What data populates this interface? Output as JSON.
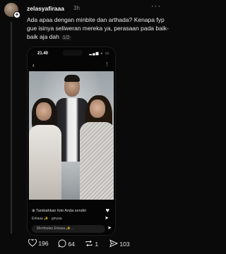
{
  "post": {
    "username": "zelasyafiraaa",
    "timestamp": "3h",
    "text": "Ada apaa dengan minbite dan arthada? Kenapa fyp gue isinya seliweran mereka ya, perasaan pada baik-baik aja dah",
    "pager": "1/2"
  },
  "embedded_screen": {
    "status_time": "21.40",
    "caption": "Tambahkan foto Anda sendiri",
    "tag_text": "Erkaaa ✨ · ginyaa",
    "reply_placeholder": "Membalas Erkaaa ✨..."
  },
  "actions": {
    "likes": "196",
    "comments": "64",
    "reposts": "1",
    "shares": "103"
  },
  "colors": {
    "background": "#0a0a0a",
    "text": "#f2f2f2",
    "muted": "#8a8a8a"
  }
}
